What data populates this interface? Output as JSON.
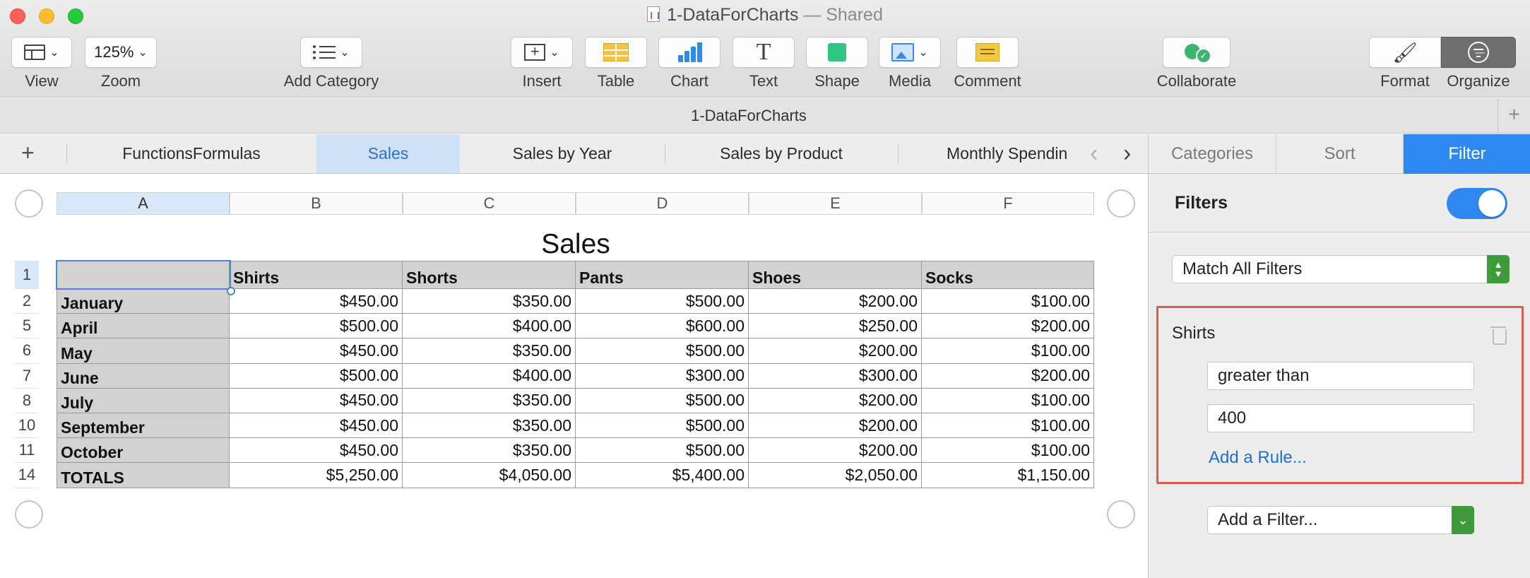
{
  "window": {
    "title": "1-DataForCharts",
    "shared_suffix": "— Shared"
  },
  "toolbar": {
    "view": "View",
    "zoom": "Zoom",
    "zoom_value": "125%",
    "add_category": "Add Category",
    "insert": "Insert",
    "table": "Table",
    "chart": "Chart",
    "text": "Text",
    "shape": "Shape",
    "media": "Media",
    "comment": "Comment",
    "collaborate": "Collaborate",
    "format": "Format",
    "organize": "Organize"
  },
  "docbar": {
    "name": "1-DataForCharts",
    "add": "+"
  },
  "sheets": {
    "add": "+",
    "tabs": [
      "FunctionsFormulas",
      "Sales",
      "Sales by Year",
      "Sales by Product",
      "Monthly Spendin"
    ],
    "active_index": 1
  },
  "columns": [
    "A",
    "B",
    "C",
    "D",
    "E",
    "F"
  ],
  "table": {
    "title": "Sales",
    "headers": [
      "",
      "Shirts",
      "Shorts",
      "Pants",
      "Shoes",
      "Socks"
    ],
    "rows": [
      {
        "num": "2",
        "label": "January",
        "values": [
          "$450.00",
          "$350.00",
          "$500.00",
          "$200.00",
          "$100.00"
        ]
      },
      {
        "num": "5",
        "label": "April",
        "values": [
          "$500.00",
          "$400.00",
          "$600.00",
          "$250.00",
          "$200.00"
        ]
      },
      {
        "num": "6",
        "label": "May",
        "values": [
          "$450.00",
          "$350.00",
          "$500.00",
          "$200.00",
          "$100.00"
        ]
      },
      {
        "num": "7",
        "label": "June",
        "values": [
          "$500.00",
          "$400.00",
          "$300.00",
          "$300.00",
          "$200.00"
        ]
      },
      {
        "num": "8",
        "label": "July",
        "values": [
          "$450.00",
          "$350.00",
          "$500.00",
          "$200.00",
          "$100.00"
        ]
      },
      {
        "num": "10",
        "label": "September",
        "values": [
          "$450.00",
          "$350.00",
          "$500.00",
          "$200.00",
          "$100.00"
        ]
      },
      {
        "num": "11",
        "label": "October",
        "values": [
          "$450.00",
          "$350.00",
          "$500.00",
          "$200.00",
          "$100.00"
        ]
      },
      {
        "num": "14",
        "label": "TOTALS",
        "values": [
          "$5,250.00",
          "$4,050.00",
          "$5,400.00",
          "$2,050.00",
          "$1,150.00"
        ]
      }
    ],
    "header_row_num": "1"
  },
  "sidebar": {
    "tabs": [
      "Categories",
      "Sort",
      "Filter"
    ],
    "active_index": 2,
    "filters_label": "Filters",
    "filters_enabled": true,
    "match_mode": "Match All Filters",
    "rule": {
      "column": "Shirts",
      "condition": "greater than",
      "value": "400",
      "add_rule": "Add a Rule..."
    },
    "add_filter": "Add a Filter..."
  },
  "colors": {
    "accent": "#2f87f0",
    "highlight_box": "#e05a55",
    "stepper_green": "#3e9a3a",
    "link": "#1f6fd2"
  }
}
